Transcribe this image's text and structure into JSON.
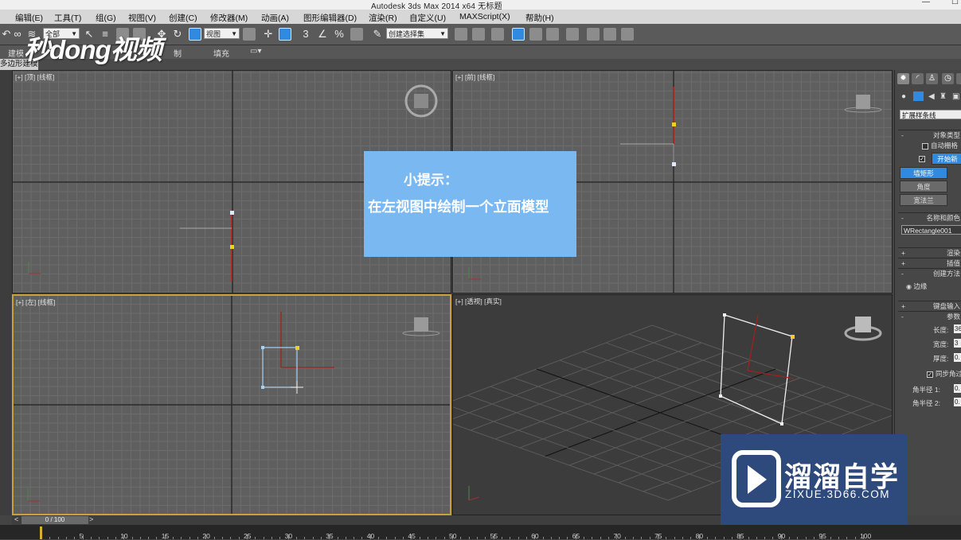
{
  "window": {
    "title": "Autodesk 3ds Max  2014 x64     无标题",
    "min_glyph": "—",
    "max_glyph": "☐"
  },
  "menu": [
    "编辑(E)",
    "工具(T)",
    "组(G)",
    "视图(V)",
    "创建(C)",
    "修改器(M)",
    "动画(A)",
    "图形编辑器(D)",
    "渲染(R)",
    "自定义(U)",
    "MAXScript(X)",
    "帮助(H)"
  ],
  "toolbar": {
    "selection_filter": "全部",
    "ref_coord": "视图",
    "named_selection": "创建选择集",
    "snap_label": "3",
    "angle_snap": "∠",
    "percent_snap": "%"
  },
  "ribbon": {
    "tabs": [
      "建模",
      "制",
      "填充"
    ],
    "sub_label": "多边形建模"
  },
  "viewports": {
    "top": {
      "label": "[+] [顶] [线框]"
    },
    "front": {
      "label": "[+] [前] [线框]"
    },
    "left": {
      "label": "[+] [左] [线框]"
    },
    "perspective": {
      "label": "[+] [透视] [真实]"
    }
  },
  "tip": {
    "title": "小提示：",
    "body": "在左视图中绘制一个立面模型"
  },
  "watermark": {
    "text": "秒dong视频"
  },
  "brand": {
    "name": "溜溜自学",
    "url": "ZIXUE.3D66.COM"
  },
  "cmd_panel": {
    "category": "扩展样条线",
    "object_type": "对象类型",
    "auto_grid": "自动栅格",
    "start_new": "开始新",
    "btn_wall": "墙矩形",
    "btn_angle": "角度",
    "btn_wide_flange": "宽法兰",
    "name_color": "名称和颜色",
    "object_name": "WRectangle001",
    "render": "渲染",
    "interp": "插值",
    "creation_method": "创建方法",
    "edge": "边缘",
    "keyboard": "键盘输入",
    "params": "参数",
    "length_label": "长度:",
    "width_label": "宽度:",
    "thick_label": "厚度:",
    "sync_corner": "同步角过",
    "radius1": "角半径 1:",
    "radius2": "角半径 2:",
    "length_val": "36",
    "width_val": "3",
    "thick_val": "0.",
    "r1_val": "0.",
    "r2_val": "0."
  },
  "timeline": {
    "frame": "0 / 100",
    "prev": "<",
    "next": ">"
  },
  "ruler_labels": [
    "5",
    "10",
    "15",
    "20",
    "25",
    "30",
    "35",
    "40",
    "45",
    "50",
    "55",
    "60",
    "65",
    "70",
    "75",
    "80",
    "85",
    "90",
    "95",
    "100"
  ]
}
